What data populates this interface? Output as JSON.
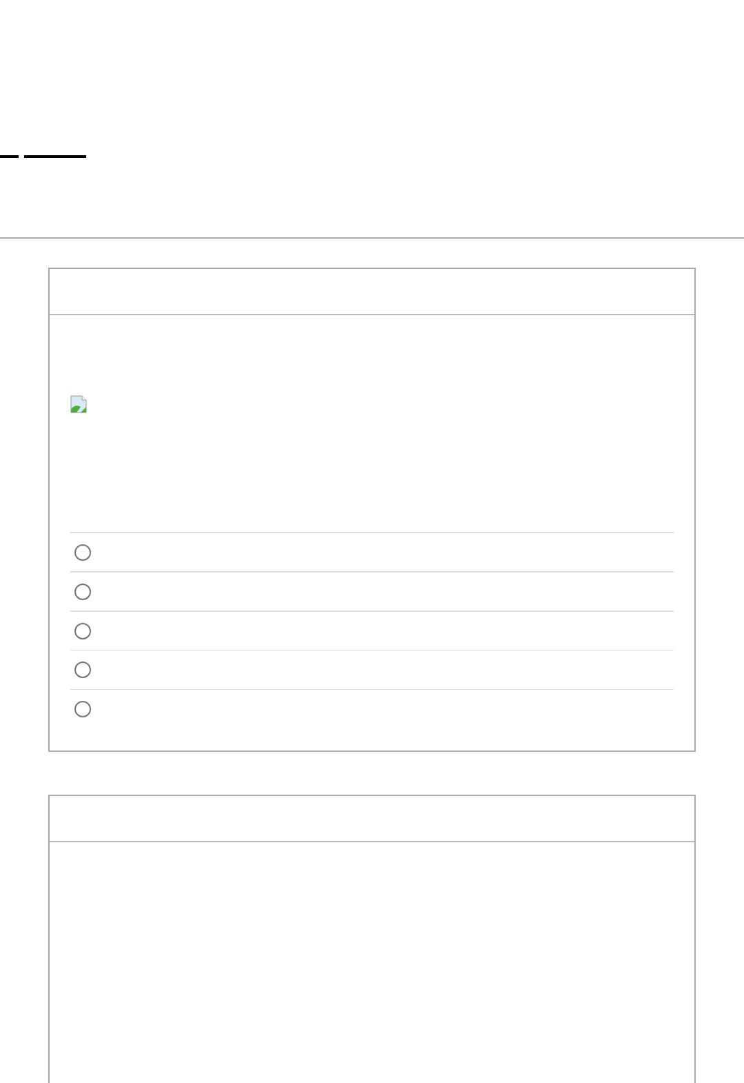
{
  "links": [
    {
      "kind": "link"
    },
    {
      "kind": "link"
    }
  ],
  "cards": [
    {
      "kind": "question",
      "image": {
        "kind": "broken-image"
      },
      "options": [
        {
          "selected": false
        },
        {
          "selected": false
        },
        {
          "selected": false
        },
        {
          "selected": false
        },
        {
          "selected": false
        }
      ]
    },
    {
      "kind": "blank"
    }
  ]
}
